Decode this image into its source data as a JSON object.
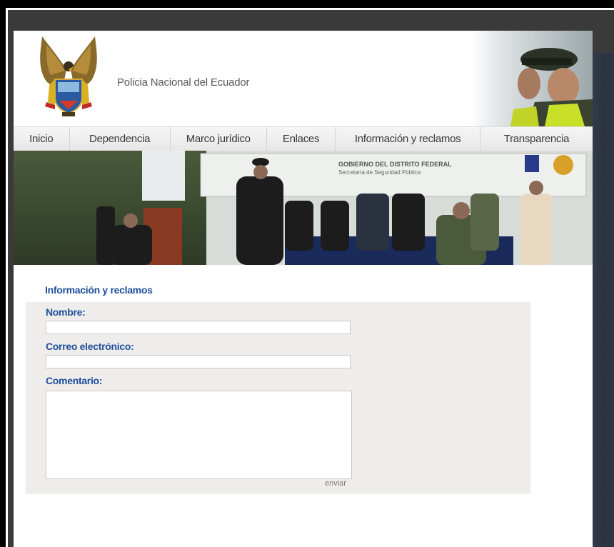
{
  "site": {
    "title": "Policia Nacional del Ecuador"
  },
  "nav": {
    "items": [
      {
        "label": "Inicio"
      },
      {
        "label": "Dependencia"
      },
      {
        "label": "Marco jurídico"
      },
      {
        "label": "Enlaces"
      },
      {
        "label": "Información y reclamos"
      },
      {
        "label": "Transparencia"
      }
    ]
  },
  "banner": {
    "sign_line1": "GOBIERNO DEL DISTRITO FEDERAL",
    "sign_line2": "Secretaría de Seguridad Pública"
  },
  "form": {
    "title": "Información y reclamos",
    "name_label": "Nombre:",
    "name_value": "",
    "email_label": "Correo electrónico:",
    "email_value": "",
    "comment_label": "Comentario:",
    "comment_value": "",
    "submit_label": "enviar"
  },
  "colors": {
    "accent": "#1f4f9a",
    "form_bg": "#efedec",
    "nav_bg": "#ececec",
    "frame": "#3a3a3a"
  }
}
